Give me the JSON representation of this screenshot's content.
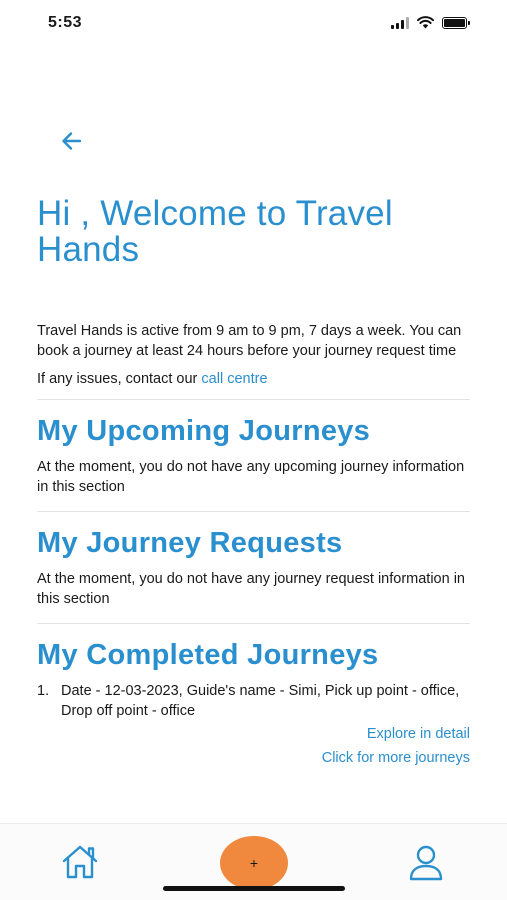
{
  "status_bar": {
    "time": "5:53"
  },
  "header": {
    "title": "Hi , Welcome to Travel Hands"
  },
  "intro": {
    "text": "Travel Hands is active from 9 am to 9 pm, 7 days a week. You can book a journey at least 24 hours before your journey request time",
    "contact_prefix": "If any issues, contact our ",
    "contact_link": "call centre"
  },
  "upcoming": {
    "title": "My Upcoming Journeys",
    "message": "At the moment, you do not have any upcoming journey information in this section"
  },
  "requests": {
    "title": "My Journey Requests",
    "message": "At the moment, you do not have any journey request information in this section"
  },
  "completed": {
    "title": "My Completed Journeys",
    "items": [
      {
        "number": "1.",
        "text": "Date - 12-03-2023, Guide's name - Simi, Pick up point - office, Drop off point - office"
      }
    ],
    "explore_link": "Explore in detail",
    "more_link": "Click for more journeys"
  },
  "tab_bar": {
    "add_label": "+"
  },
  "colors": {
    "accent": "#2a8fce",
    "fab": "#f0883d"
  }
}
